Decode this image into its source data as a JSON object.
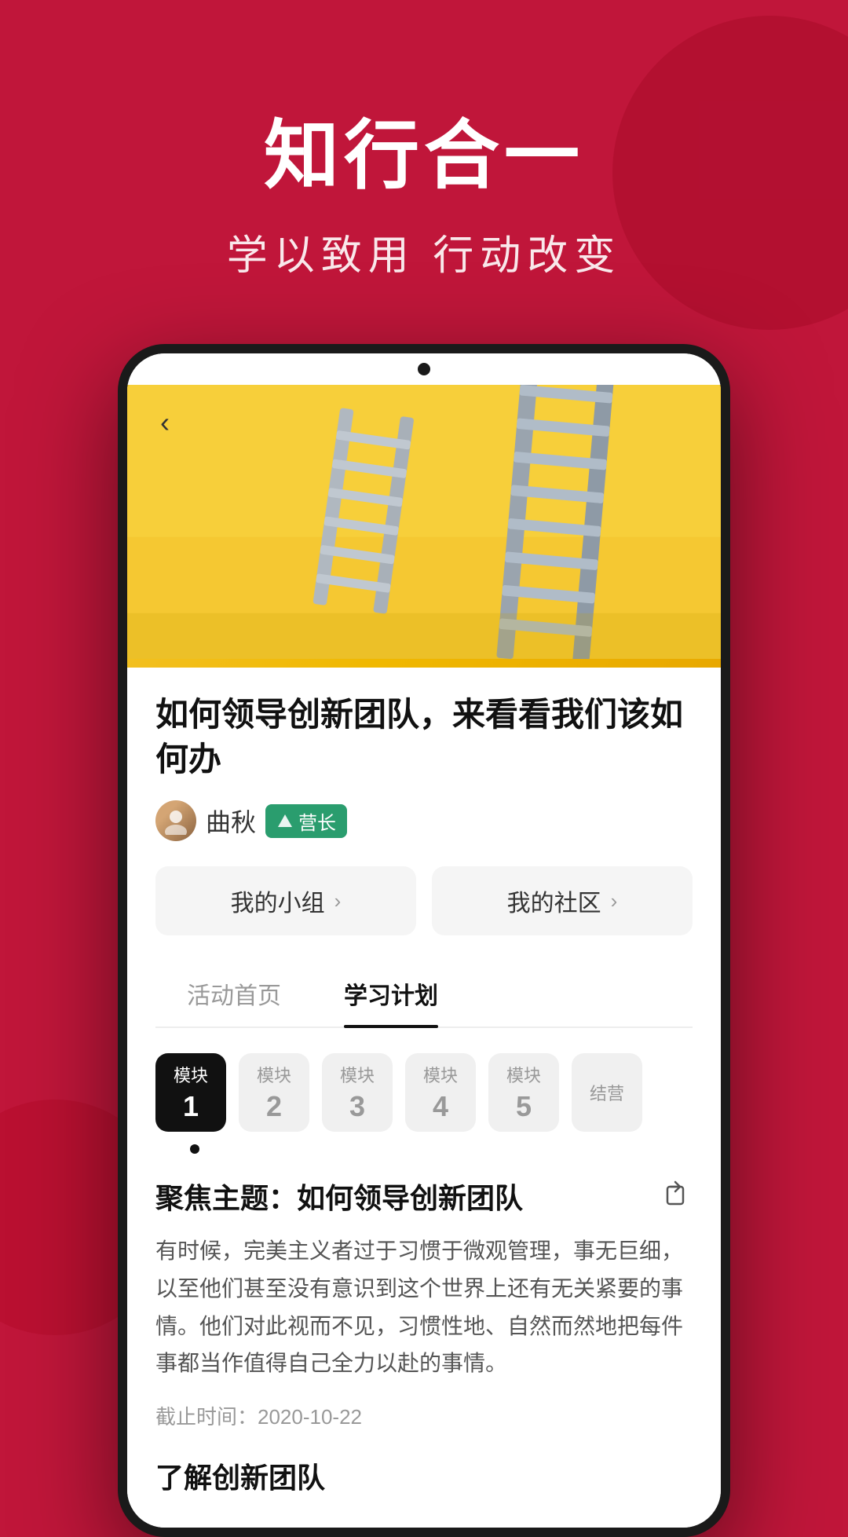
{
  "hero": {
    "title": "知行合一",
    "subtitle": "学以致用 行动改变"
  },
  "phone": {
    "back_button": "‹",
    "article_header_alt": "yellow wall with ladders"
  },
  "article": {
    "title": "如何领导创新团队，来看看我们该如何办",
    "author_name": "曲秋",
    "author_badge": "营长",
    "nav_my_group": "我的小组",
    "nav_my_community": "我的社区",
    "tab_activity_home": "活动首页",
    "tab_study_plan": "学习计划",
    "modules": [
      {
        "label": "模块",
        "num": "1",
        "active": true
      },
      {
        "label": "模块",
        "num": "2",
        "active": false
      },
      {
        "label": "模块",
        "num": "3",
        "active": false
      },
      {
        "label": "模块",
        "num": "4",
        "active": false
      },
      {
        "label": "模块",
        "num": "5",
        "active": false
      },
      {
        "label": "结营",
        "num": "",
        "active": false
      }
    ],
    "focus_theme_label": "聚焦主题：如何领导创新团队",
    "body_text": "有时候，完美主义者过于习惯于微观管理，事无巨细，以至他们甚至没有意识到这个世界上还有无关紧要的事情。他们对此视而不见，习惯性地、自然而然地把每件事都当作值得自己全力以赴的事情。",
    "deadline_label": "截止时间：2020-10-22",
    "understand_team_label": "了解创新团队"
  }
}
